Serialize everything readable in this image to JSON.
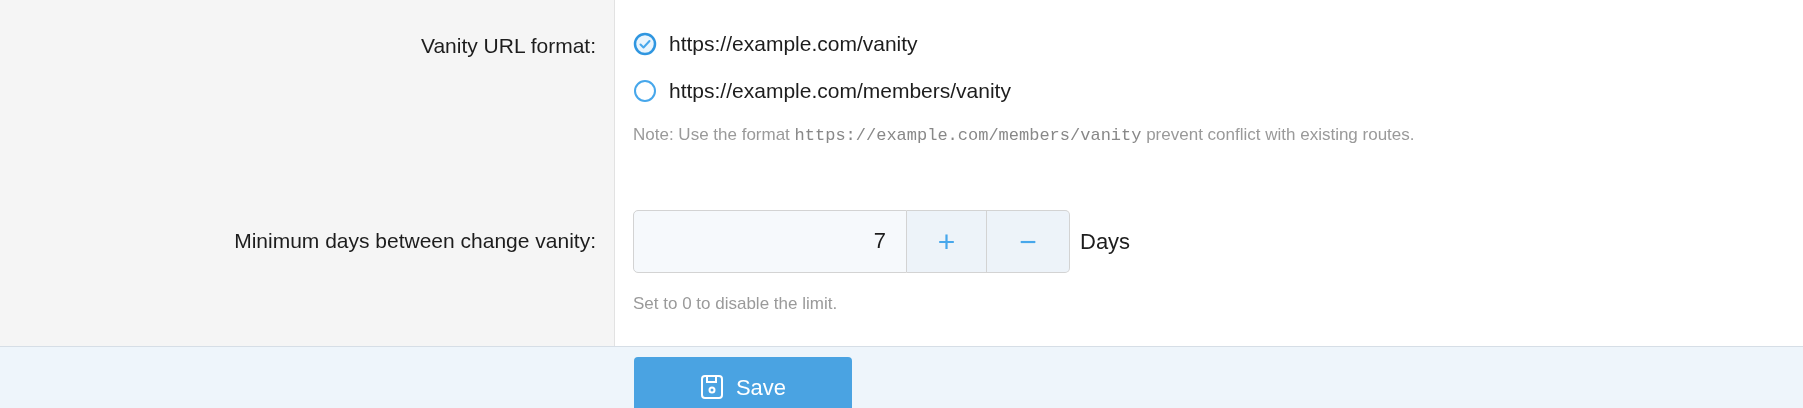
{
  "rows": [
    {
      "kind": "radio",
      "label": "Vanity URL format:",
      "options": [
        {
          "label": "https://example.com/vanity",
          "selected": true
        },
        {
          "label": "https://example.com/members/vanity",
          "selected": false
        }
      ],
      "note": [
        {
          "kind": "text",
          "text": "Note: Use the format "
        },
        {
          "kind": "code",
          "text": "https://example.com/members/vanity"
        },
        {
          "kind": "text",
          "text": " prevent conflict with existing routes."
        }
      ]
    },
    {
      "kind": "spinner",
      "label": "Minimum days between change vanity:",
      "value": "7",
      "increment": "+",
      "decrement": "−",
      "unit": "Days",
      "note": [
        {
          "kind": "text",
          "text": "Set to 0 to disable the limit."
        }
      ]
    }
  ],
  "submit": {
    "label": "Save"
  }
}
